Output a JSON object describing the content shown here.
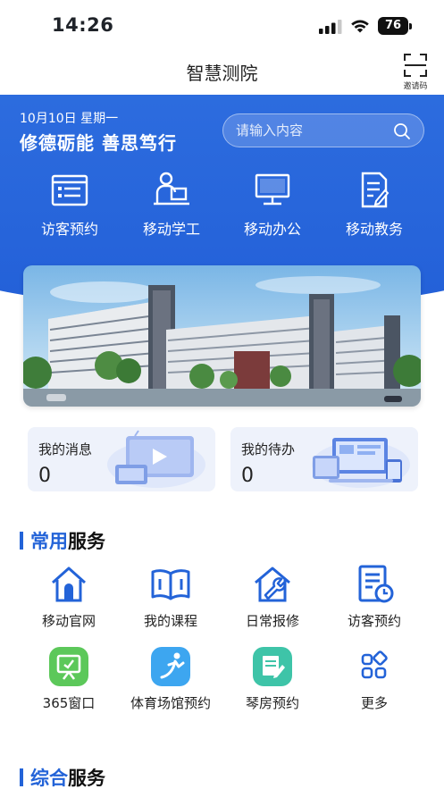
{
  "status": {
    "time": "14:26",
    "battery": "76"
  },
  "header": {
    "title": "智慧测院",
    "scan_label": "邀请码"
  },
  "hero": {
    "date": "10月10日 星期一",
    "motto": "修德砺能  善思笃行",
    "search_placeholder": "请输入内容",
    "quick": [
      {
        "label": "访客预约",
        "icon": "visitor-form-icon"
      },
      {
        "label": "移动学工",
        "icon": "student-desk-icon"
      },
      {
        "label": "移动办公",
        "icon": "monitor-icon"
      },
      {
        "label": "移动教务",
        "icon": "document-edit-icon"
      }
    ]
  },
  "cards": {
    "messages": {
      "title": "我的消息",
      "count": "0"
    },
    "todo": {
      "title": "我的待办",
      "count": "0"
    }
  },
  "common": {
    "title_highlight": "常用",
    "title_rest": "服务",
    "items": [
      {
        "label": "移动官网",
        "icon": "home-icon"
      },
      {
        "label": "我的课程",
        "icon": "book-icon"
      },
      {
        "label": "日常报修",
        "icon": "repair-icon"
      },
      {
        "label": "访客预约",
        "icon": "calendar-doc-icon"
      },
      {
        "label": "365窗口",
        "icon": "window-365-icon"
      },
      {
        "label": "体育场馆预约",
        "icon": "sports-icon"
      },
      {
        "label": "琴房预约",
        "icon": "piano-room-icon"
      },
      {
        "label": "更多",
        "icon": "more-grid-icon"
      }
    ]
  },
  "general": {
    "title_highlight": "综合",
    "title_rest": "服务"
  },
  "colors": {
    "primary": "#2363d8",
    "green": "#5cc85a",
    "sky": "#3da6f0",
    "teal": "#3ec4a8"
  }
}
